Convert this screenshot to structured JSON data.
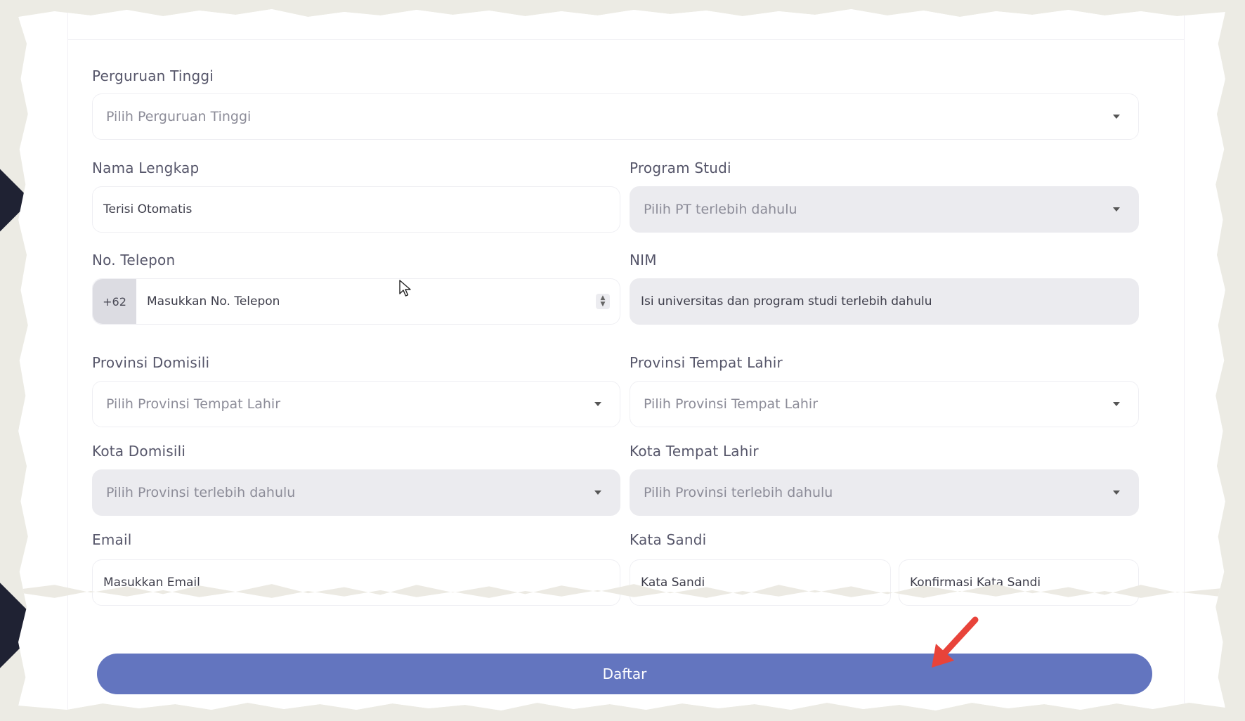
{
  "form": {
    "perguruan_tinggi": {
      "label": "Perguruan Tinggi",
      "placeholder": "Pilih Perguruan Tinggi"
    },
    "nama_lengkap": {
      "label": "Nama Lengkap",
      "value": "Terisi Otomatis"
    },
    "program_studi": {
      "label": "Program Studi",
      "placeholder": "Pilih PT terlebih dahulu"
    },
    "no_telepon": {
      "label": "No. Telepon",
      "prefix": "+62",
      "placeholder": "Masukkan No. Telepon"
    },
    "nim": {
      "label": "NIM",
      "placeholder": "Isi universitas dan program studi terlebih dahulu"
    },
    "provinsi_domisili": {
      "label": "Provinsi Domisili",
      "placeholder": "Pilih Provinsi Tempat Lahir"
    },
    "provinsi_tempat_lahir": {
      "label": "Provinsi Tempat Lahir",
      "placeholder": "Pilih Provinsi Tempat Lahir"
    },
    "kota_domisili": {
      "label": "Kota Domisili",
      "placeholder": "Pilih Provinsi terlebih dahulu"
    },
    "kota_tempat_lahir": {
      "label": "Kota Tempat Lahir",
      "placeholder": "Pilih Provinsi terlebih dahulu"
    },
    "email": {
      "label": "Email",
      "placeholder": "Masukkan Email"
    },
    "kata_sandi": {
      "label": "Kata Sandi",
      "placeholder": "Kata Sandi",
      "confirm_placeholder": "Konfirmasi Kata Sandi"
    },
    "submit_label": "Daftar"
  },
  "colors": {
    "primary": "#6375bf",
    "annotation_arrow": "#e8433a",
    "disabled_field": "#ebebef"
  },
  "icons": [
    "cursor-pointer-icon",
    "red-arrow-annotation-icon",
    "dropdown-caret-icon",
    "number-spinner-icon"
  ]
}
